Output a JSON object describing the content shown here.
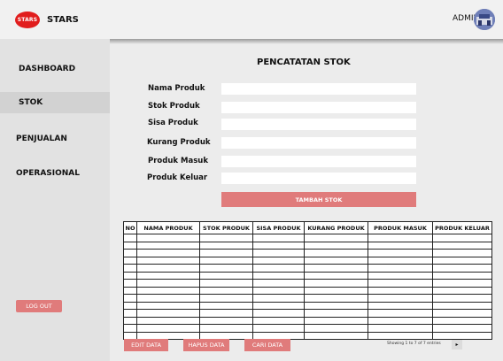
{
  "header": {
    "logo_text": "STARS",
    "brand": "STARS",
    "user_label": "ADMIN"
  },
  "sidebar": {
    "items": [
      {
        "label": "DASHBOARD"
      },
      {
        "label": "STOK",
        "active": true
      },
      {
        "label": "PENJUALAN"
      },
      {
        "label": "OPERASIONAL"
      }
    ],
    "logout_label": "LOG OUT"
  },
  "main": {
    "title": "PENCATATAN STOK",
    "form": {
      "fields": [
        {
          "label": "Nama Produk",
          "value": ""
        },
        {
          "label": "Stok Produk",
          "value": ""
        },
        {
          "label": "Sisa Produk",
          "value": ""
        },
        {
          "label": "Kurang Produk",
          "value": ""
        },
        {
          "label": "Produk Masuk",
          "value": ""
        },
        {
          "label": "Produk Keluar",
          "value": ""
        }
      ],
      "submit_label": "TAMBAH STOK"
    },
    "table": {
      "columns": [
        "NO",
        "NAMA PRODUK",
        "STOK PRODUK",
        "SISA PRODUK",
        "KURANG PRODUK",
        "PRODUK MASUK",
        "PRODUK KELUAR"
      ]
    },
    "actions": {
      "edit_label": "EDIT DATA",
      "delete_label": "HAPUS DATA",
      "search_label": "CARI DATA"
    },
    "pagination": {
      "info": "Showing 1 to 7 of 7 entries",
      "next_label": "▸"
    }
  },
  "colors": {
    "accent": "#e07b7b",
    "logo": "#e11d1d"
  }
}
